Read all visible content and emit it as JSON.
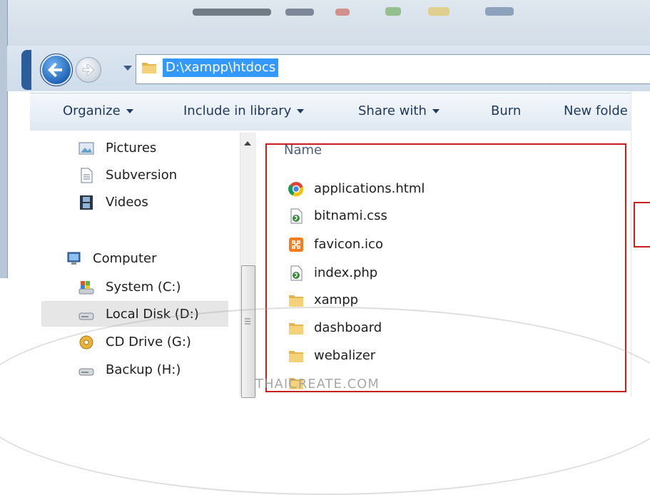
{
  "address_bar": {
    "path": "D:\\xampp\\htdocs"
  },
  "toolbar": {
    "items": [
      {
        "label": "Organize",
        "has_dropdown": true
      },
      {
        "label": "Include in library",
        "has_dropdown": true
      },
      {
        "label": "Share with",
        "has_dropdown": true
      },
      {
        "label": "Burn",
        "has_dropdown": false
      },
      {
        "label": "New folde",
        "has_dropdown": false
      }
    ]
  },
  "nav_pane": {
    "items": [
      {
        "label": "Pictures",
        "icon": "pictures-icon"
      },
      {
        "label": "Subversion",
        "icon": "document-icon"
      },
      {
        "label": "Videos",
        "icon": "videos-icon"
      },
      {
        "label": "Computer",
        "icon": "computer-icon"
      },
      {
        "label": "System  (C:)",
        "icon": "system-drive-icon"
      },
      {
        "label": "Local Disk (D:)",
        "icon": "hard-drive-icon",
        "selected": true
      },
      {
        "label": "CD Drive (G:)",
        "icon": "cd-drive-icon"
      },
      {
        "label": "Backup (H:)",
        "icon": "hard-drive-icon"
      }
    ]
  },
  "file_list": {
    "column_name": "Name",
    "items": [
      {
        "name": "applications.html",
        "icon": "chrome-icon"
      },
      {
        "name": "bitnami.css",
        "icon": "script-file-icon"
      },
      {
        "name": "favicon.ico",
        "icon": "xampp-icon"
      },
      {
        "name": "index.php",
        "icon": "script-file-icon"
      },
      {
        "name": "xampp",
        "icon": "folder-icon"
      },
      {
        "name": "dashboard",
        "icon": "folder-icon"
      },
      {
        "name": "webalizer",
        "icon": "folder-icon"
      }
    ]
  },
  "watermark": {
    "text": "THAICREATE.COM"
  },
  "colors": {
    "highlight_box": "#c81e1e",
    "address_selection": "#3399ff",
    "toolbar_text": "#1e395b"
  }
}
